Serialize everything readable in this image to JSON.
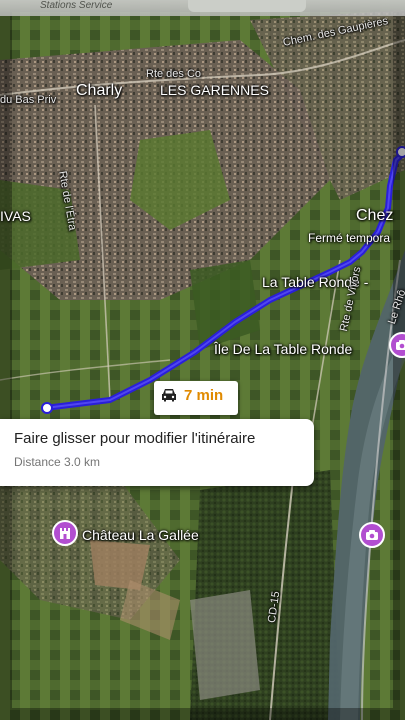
{
  "header": {
    "partial_text": "Stations Service"
  },
  "places": {
    "charly": "Charly",
    "les_garennes": "LES GARENNES",
    "chez": "Chez",
    "ferme_temporairement": "Fermé tempora",
    "la_table_ronde": "La Table Ronde -",
    "ile_table_ronde": "Île De La Table Ronde",
    "chateau": "Château La Gallée",
    "vivas": "IVAS"
  },
  "roads": {
    "chem_gaupieres": "Chem. des Gaupières",
    "rte_des_co": "Rte des Co",
    "du_bas_privas": "du Bas Priv",
    "rte_etra": "Rte de l'Étra",
    "rte_vivors": "Rte de Vivors",
    "le_rhone": "Le Rhô",
    "cd15": "CD-15"
  },
  "route": {
    "duration": "7 min",
    "drag_hint": "Faire glisser pour modifier l'itinéraire",
    "distance": "Distance 3.0 km",
    "color": "#2a1fd9"
  },
  "icons": {
    "car": "car-icon",
    "camera": "camera-icon",
    "landmark": "landmark-icon"
  }
}
